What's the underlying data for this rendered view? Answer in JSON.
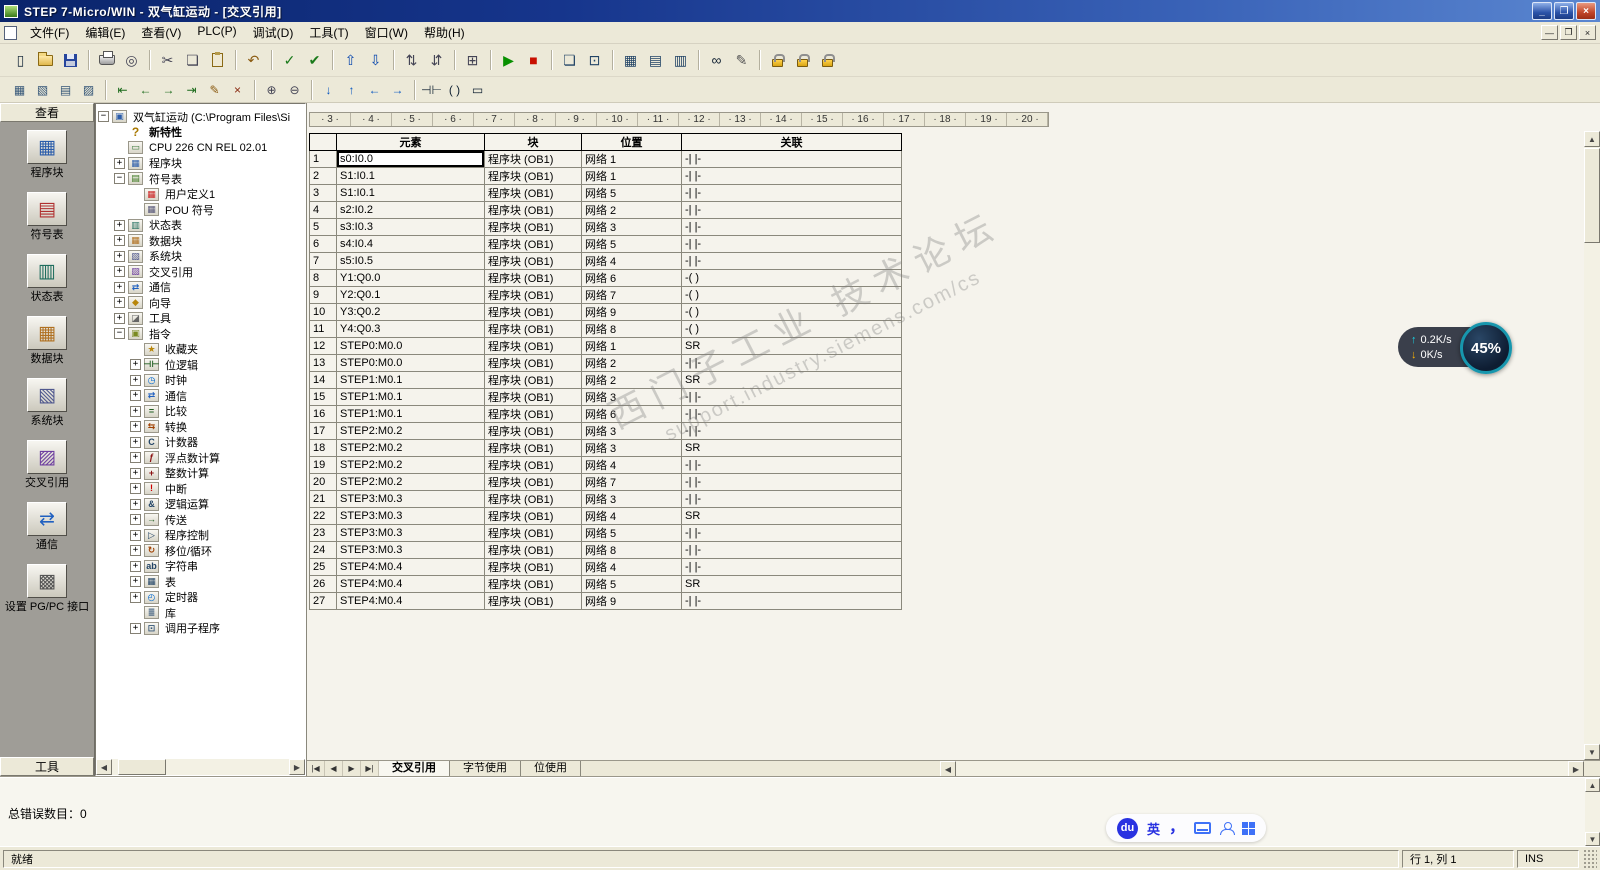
{
  "window": {
    "title": "STEP 7-Micro/WIN - 双气缸运动 - [交叉引用]",
    "buttons": {
      "minimize": "_",
      "restore": "❐",
      "close": "×"
    }
  },
  "mdi": {
    "buttons": {
      "minimize": "—",
      "restore": "❐",
      "close": "×"
    }
  },
  "menu": [
    {
      "key": "file",
      "label": "文件(F)"
    },
    {
      "key": "edit",
      "label": "编辑(E)"
    },
    {
      "key": "view",
      "label": "查看(V)"
    },
    {
      "key": "plc",
      "label": "PLC(P)"
    },
    {
      "key": "debug",
      "label": "调试(D)"
    },
    {
      "key": "tools",
      "label": "工具(T)"
    },
    {
      "key": "window",
      "label": "窗口(W)"
    },
    {
      "key": "help",
      "label": "帮助(H)"
    }
  ],
  "toolbar1": [
    {
      "name": "new",
      "glyph": "▯",
      "color": "#223344"
    },
    {
      "name": "open",
      "css": "folder"
    },
    {
      "name": "save",
      "css": "disk"
    },
    {
      "sep": true
    },
    {
      "name": "print",
      "css": "printer"
    },
    {
      "name": "print-preview",
      "glyph": "◎",
      "color": "#444455"
    },
    {
      "sep": true
    },
    {
      "name": "cut",
      "glyph": "✂",
      "color": "#444455"
    },
    {
      "name": "copy",
      "glyph": "❏",
      "color": "#444455"
    },
    {
      "name": "paste",
      "css": "paste"
    },
    {
      "sep": true
    },
    {
      "name": "undo",
      "glyph": "↶",
      "color": "#8a5a10"
    },
    {
      "sep": true
    },
    {
      "name": "compile",
      "glyph": "✓",
      "color": "#1a7a1a"
    },
    {
      "name": "compile-all",
      "glyph": "✔",
      "color": "#1a7a1a"
    },
    {
      "sep": true
    },
    {
      "name": "upload",
      "glyph": "⇧",
      "color": "#0645ad"
    },
    {
      "name": "download",
      "glyph": "⇩",
      "color": "#0645ad"
    },
    {
      "sep": true
    },
    {
      "name": "sort-ascending",
      "glyph": "⇅",
      "color": "#444455"
    },
    {
      "name": "sort-descending",
      "glyph": "⇵",
      "color": "#444455"
    },
    {
      "sep": true
    },
    {
      "name": "options",
      "glyph": "⊞",
      "color": "#444455"
    },
    {
      "sep": true
    },
    {
      "name": "run",
      "glyph": "▶",
      "color": "#089000"
    },
    {
      "name": "stop",
      "glyph": "■",
      "color": "#c81000"
    },
    {
      "sep": true
    },
    {
      "name": "program-status",
      "glyph": "❏",
      "color": "#224466"
    },
    {
      "name": "pause-program-status",
      "glyph": "⊡",
      "color": "#224466"
    },
    {
      "sep": true
    },
    {
      "name": "symbol-table-view",
      "glyph": "▦",
      "color": "#224466"
    },
    {
      "name": "status-chart-view",
      "glyph": "▤",
      "color": "#224466"
    },
    {
      "name": "data-block-view",
      "glyph": "▥",
      "color": "#224466"
    },
    {
      "sep": true
    },
    {
      "name": "program-monitor",
      "glyph": "∞",
      "color": "#112233"
    },
    {
      "name": "chart-monitor",
      "glyph": "✎",
      "color": "#555555"
    },
    {
      "sep": true
    },
    {
      "name": "force",
      "css": "lock"
    },
    {
      "name": "unforce",
      "css": "lock"
    },
    {
      "name": "unforce-all",
      "css": "lock"
    }
  ],
  "toolbar2": [
    {
      "name": "insert-network",
      "glyph": "▦",
      "color": "#335577"
    },
    {
      "name": "delete-network",
      "glyph": "▧",
      "color": "#335577"
    },
    {
      "name": "pou-comments",
      "glyph": "▤",
      "color": "#335577"
    },
    {
      "name": "view-symbol-info",
      "glyph": "▨",
      "color": "#335577"
    },
    {
      "sep": true
    },
    {
      "name": "goto-first",
      "glyph": "⇤",
      "color": "#1a6a1a"
    },
    {
      "name": "goto-previous",
      "glyph": "←",
      "color": "#1a6a1a"
    },
    {
      "name": "goto-next",
      "glyph": "→",
      "color": "#1a6a1a"
    },
    {
      "name": "goto-last",
      "glyph": "⇥",
      "color": "#1a6a1a"
    },
    {
      "name": "edit-cell",
      "glyph": "✎",
      "color": "#8a5a10"
    },
    {
      "name": "clear-cell",
      "glyph": "×",
      "color": "#8a2a10"
    },
    {
      "sep": true
    },
    {
      "name": "zoom-in",
      "glyph": "⊕",
      "color": "#444455"
    },
    {
      "name": "zoom-out",
      "glyph": "⊖",
      "color": "#444455"
    },
    {
      "sep": true
    },
    {
      "name": "line-down",
      "glyph": "↓",
      "color": "#0a58c0"
    },
    {
      "name": "line-up",
      "glyph": "↑",
      "color": "#0a58c0"
    },
    {
      "name": "line-left",
      "glyph": "←",
      "color": "#0a58c0"
    },
    {
      "name": "line-right",
      "glyph": "→",
      "color": "#0a58c0"
    },
    {
      "sep": true
    },
    {
      "name": "insert-contact",
      "glyph": "⊣⊢",
      "color": "#112233"
    },
    {
      "name": "insert-coil",
      "glyph": "( )",
      "color": "#112233"
    },
    {
      "name": "insert-box",
      "glyph": "▭",
      "color": "#112233"
    }
  ],
  "sidebar": {
    "header": "查看",
    "footer": "工具",
    "items": [
      {
        "key": "program-block",
        "label": "程序块",
        "icon": "program-block-icon",
        "glyph": "▦",
        "color": "#2a5caa"
      },
      {
        "key": "symbol-table",
        "label": "符号表",
        "icon": "symbol-table-icon",
        "glyph": "▤",
        "color": "#b03030"
      },
      {
        "key": "status-chart",
        "label": "状态表",
        "icon": "status-chart-icon",
        "glyph": "▥",
        "color": "#1f6e5e"
      },
      {
        "key": "data-block",
        "label": "数据块",
        "icon": "data-block-icon",
        "glyph": "▦",
        "color": "#b07020"
      },
      {
        "key": "system-block",
        "label": "系统块",
        "icon": "system-block-icon",
        "glyph": "▧",
        "color": "#50588e"
      },
      {
        "key": "cross-reference",
        "label": "交叉引用",
        "icon": "cross-reference-icon",
        "glyph": "▨",
        "color": "#6e3fa0"
      },
      {
        "key": "communications",
        "label": "通信",
        "icon": "communications-icon",
        "glyph": "⇄",
        "color": "#2060c0"
      },
      {
        "key": "set-pg-pc-interface",
        "label": "设置 PG/PC 接口",
        "icon": "set-pg-pc-interface-icon",
        "glyph": "▩",
        "color": "#555555"
      }
    ]
  },
  "tree": {
    "items": [
      {
        "key": "project-root",
        "level": 0,
        "toggle": "minus",
        "icon": "project-icon",
        "glyph": "▣",
        "color": "#2a5caa",
        "label": "双气缸运动 (C:\\Program Files\\Si"
      },
      {
        "key": "new-features",
        "level": 1,
        "toggle": "none",
        "icon": "new-features-icon",
        "glyph": "?",
        "color": "#a87800",
        "nobox": true,
        "bold": true,
        "label": "新特性"
      },
      {
        "key": "cpu",
        "level": 1,
        "toggle": "none",
        "icon": "cpu-icon",
        "glyph": "▭",
        "color": "#3a7a3a",
        "label": "CPU 226 CN REL 02.01"
      },
      {
        "key": "program-block",
        "level": 1,
        "toggle": "plus",
        "icon": "program-block-icon",
        "glyph": "▦",
        "color": "#2a5caa",
        "label": "程序块"
      },
      {
        "key": "symbol-table",
        "level": 1,
        "toggle": "minus",
        "icon": "symbol-table-folder-icon",
        "glyph": "▤",
        "color": "#38761d",
        "label": "符号表"
      },
      {
        "key": "user-defined-1",
        "level": 2,
        "toggle": "none",
        "icon": "user-defined-table-icon",
        "glyph": "▦",
        "color": "#cc2222",
        "label": "用户定义1"
      },
      {
        "key": "pou-symbols",
        "level": 2,
        "toggle": "none",
        "icon": "pou-symbols-icon",
        "glyph": "▦",
        "color": "#555577",
        "label": "POU 符号"
      },
      {
        "key": "status-chart",
        "level": 1,
        "toggle": "plus",
        "icon": "status-chart-icon",
        "glyph": "▥",
        "color": "#1f6e5e",
        "label": "状态表"
      },
      {
        "key": "data-block",
        "level": 1,
        "toggle": "plus",
        "icon": "data-block-icon",
        "glyph": "▦",
        "color": "#b07020",
        "label": "数据块"
      },
      {
        "key": "system-block",
        "level": 1,
        "toggle": "plus",
        "icon": "system-block-icon",
        "glyph": "▧",
        "color": "#50588e",
        "label": "系统块"
      },
      {
        "key": "cross-reference",
        "level": 1,
        "toggle": "plus",
        "icon": "cross-reference-icon",
        "glyph": "▨",
        "color": "#6e3fa0",
        "label": "交叉引用"
      },
      {
        "key": "communications",
        "level": 1,
        "toggle": "plus",
        "icon": "communications-icon",
        "glyph": "⇄",
        "color": "#2060c0",
        "label": "通信"
      },
      {
        "key": "wizards",
        "level": 1,
        "toggle": "plus",
        "icon": "wizard-icon",
        "glyph": "◆",
        "color": "#b8860b",
        "label": "向导"
      },
      {
        "key": "tools",
        "level": 1,
        "toggle": "plus",
        "icon": "tools-icon",
        "glyph": "◪",
        "color": "#666666",
        "label": "工具"
      },
      {
        "key": "instructions",
        "level": 1,
        "toggle": "minus",
        "icon": "instructions-icon",
        "glyph": "▣",
        "color": "#7a8a20",
        "label": "指令"
      },
      {
        "key": "favorites",
        "level": 2,
        "toggle": "none",
        "icon": "favorites-icon",
        "glyph": "★",
        "color": "#b8860b",
        "label": "收藏夹"
      },
      {
        "key": "bit-logic",
        "level": 2,
        "toggle": "plus",
        "icon": "bit-logic-icon",
        "glyph": "⊣⊢",
        "color": "#205e20",
        "label": "位逻辑"
      },
      {
        "key": "clock",
        "level": 2,
        "toggle": "plus",
        "icon": "clock-icon",
        "glyph": "◷",
        "color": "#0066cc",
        "label": "时钟"
      },
      {
        "key": "communications-instructions",
        "level": 2,
        "toggle": "plus",
        "icon": "comm-instructions-icon",
        "glyph": "⇄",
        "color": "#2060c0",
        "label": "通信"
      },
      {
        "key": "compare",
        "level": 2,
        "toggle": "plus",
        "icon": "compare-icon",
        "glyph": "=",
        "color": "#205e20",
        "label": "比较"
      },
      {
        "key": "convert",
        "level": 2,
        "toggle": "plus",
        "icon": "convert-icon",
        "glyph": "⇆",
        "color": "#a04000",
        "label": "转换"
      },
      {
        "key": "counters",
        "level": 2,
        "toggle": "plus",
        "icon": "counters-icon",
        "glyph": "C",
        "color": "#224466",
        "label": "计数器"
      },
      {
        "key": "floating-point-math",
        "level": 2,
        "toggle": "plus",
        "icon": "float-math-icon",
        "glyph": "ƒ",
        "color": "#8a1010",
        "label": "浮点数计算"
      },
      {
        "key": "integer-math",
        "level": 2,
        "toggle": "plus",
        "icon": "integer-math-icon",
        "glyph": "+",
        "color": "#8a1010",
        "label": "整数计算"
      },
      {
        "key": "interrupt",
        "level": 2,
        "toggle": "plus",
        "icon": "interrupt-icon",
        "glyph": "!",
        "color": "#cc0000",
        "label": "中断"
      },
      {
        "key": "logical-operations",
        "level": 2,
        "toggle": "plus",
        "icon": "logic-ops-icon",
        "glyph": "&",
        "color": "#224466",
        "label": "逻辑运算"
      },
      {
        "key": "move",
        "level": 2,
        "toggle": "plus",
        "icon": "move-icon",
        "glyph": "→",
        "color": "#205e20",
        "label": "传送"
      },
      {
        "key": "program-control",
        "level": 2,
        "toggle": "plus",
        "icon": "program-control-icon",
        "glyph": "▷",
        "color": "#224466",
        "label": "程序控制"
      },
      {
        "key": "shift-rotate",
        "level": 2,
        "toggle": "plus",
        "icon": "shift-rotate-icon",
        "glyph": "↻",
        "color": "#a04000",
        "label": "移位/循环"
      },
      {
        "key": "string",
        "level": 2,
        "toggle": "plus",
        "icon": "string-icon",
        "glyph": "ab",
        "color": "#224466",
        "label": "字符串"
      },
      {
        "key": "table",
        "level": 2,
        "toggle": "plus",
        "icon": "table-instructions-icon",
        "glyph": "▦",
        "color": "#224466",
        "label": "表"
      },
      {
        "key": "timers",
        "level": 2,
        "toggle": "plus",
        "icon": "timers-icon",
        "glyph": "◴",
        "color": "#0066cc",
        "label": "定时器"
      },
      {
        "key": "libraries",
        "level": 2,
        "toggle": "none",
        "icon": "libraries-icon",
        "glyph": "≣",
        "color": "#335577",
        "label": "库"
      },
      {
        "key": "call-subroutines",
        "level": 2,
        "toggle": "plus",
        "icon": "call-subroutines-icon",
        "glyph": "⊡",
        "color": "#335577",
        "label": "调用子程序"
      }
    ]
  },
  "ruler": {
    "numbers": [
      3,
      4,
      5,
      6,
      7,
      8,
      9,
      10,
      11,
      12,
      13,
      14,
      15,
      16,
      17,
      18,
      19,
      20
    ]
  },
  "table": {
    "columns": [
      "元素",
      "块",
      "位置",
      "关联"
    ],
    "col_keys": [
      "element",
      "block",
      "location",
      "association"
    ],
    "selected": {
      "row": 0,
      "col": 0
    },
    "rows": [
      [
        "s0:I0.0",
        "程序块 (OB1)",
        "网络 1",
        "-| |-"
      ],
      [
        "S1:I0.1",
        "程序块 (OB1)",
        "网络 1",
        "-| |-"
      ],
      [
        "S1:I0.1",
        "程序块 (OB1)",
        "网络 5",
        "-| |-"
      ],
      [
        "s2:I0.2",
        "程序块 (OB1)",
        "网络 2",
        "-| |-"
      ],
      [
        "s3:I0.3",
        "程序块 (OB1)",
        "网络 3",
        "-| |-"
      ],
      [
        "s4:I0.4",
        "程序块 (OB1)",
        "网络 5",
        "-| |-"
      ],
      [
        "s5:I0.5",
        "程序块 (OB1)",
        "网络 4",
        "-| |-"
      ],
      [
        "Y1:Q0.0",
        "程序块 (OB1)",
        "网络 6",
        "-( )"
      ],
      [
        "Y2:Q0.1",
        "程序块 (OB1)",
        "网络 7",
        "-( )"
      ],
      [
        "Y3:Q0.2",
        "程序块 (OB1)",
        "网络 9",
        "-( )"
      ],
      [
        "Y4:Q0.3",
        "程序块 (OB1)",
        "网络 8",
        "-( )"
      ],
      [
        "STEP0:M0.0",
        "程序块 (OB1)",
        "网络 1",
        "SR"
      ],
      [
        "STEP0:M0.0",
        "程序块 (OB1)",
        "网络 2",
        "-| |-"
      ],
      [
        "STEP1:M0.1",
        "程序块 (OB1)",
        "网络 2",
        "SR"
      ],
      [
        "STEP1:M0.1",
        "程序块 (OB1)",
        "网络 3",
        "-| |-"
      ],
      [
        "STEP1:M0.1",
        "程序块 (OB1)",
        "网络 6",
        "-| |-"
      ],
      [
        "STEP2:M0.2",
        "程序块 (OB1)",
        "网络 3",
        "-| |-"
      ],
      [
        "STEP2:M0.2",
        "程序块 (OB1)",
        "网络 3",
        "SR"
      ],
      [
        "STEP2:M0.2",
        "程序块 (OB1)",
        "网络 4",
        "-| |-"
      ],
      [
        "STEP2:M0.2",
        "程序块 (OB1)",
        "网络 7",
        "-| |-"
      ],
      [
        "STEP3:M0.3",
        "程序块 (OB1)",
        "网络 3",
        "-| |-"
      ],
      [
        "STEP3:M0.3",
        "程序块 (OB1)",
        "网络 4",
        "SR"
      ],
      [
        "STEP3:M0.3",
        "程序块 (OB1)",
        "网络 5",
        "-| |-"
      ],
      [
        "STEP3:M0.3",
        "程序块 (OB1)",
        "网络 8",
        "-| |-"
      ],
      [
        "STEP4:M0.4",
        "程序块 (OB1)",
        "网络 4",
        "-| |-"
      ],
      [
        "STEP4:M0.4",
        "程序块 (OB1)",
        "网络 5",
        "SR"
      ],
      [
        "STEP4:M0.4",
        "程序块 (OB1)",
        "网络 9",
        "-| |-"
      ]
    ]
  },
  "tabs": {
    "nav": [
      {
        "name": "first-tab-button",
        "glyph": "|◀"
      },
      {
        "name": "previous-tab-button",
        "glyph": "◀"
      },
      {
        "name": "next-tab-button",
        "glyph": "▶"
      },
      {
        "name": "last-tab-button",
        "glyph": "▶|"
      }
    ],
    "items": [
      {
        "key": "cross-reference",
        "label": "交叉引用",
        "active": true
      },
      {
        "key": "byte-usage",
        "label": "字节使用",
        "active": false
      },
      {
        "key": "bit-usage",
        "label": "位使用",
        "active": false
      }
    ]
  },
  "scroll": {
    "up": "▲",
    "down": "▼",
    "left": "◀",
    "right": "▶"
  },
  "output": {
    "label": "总错误数目：0"
  },
  "statusbar": {
    "ready": "就绪",
    "position": "行 1, 列 1",
    "mode": "INS"
  },
  "speed_widget": {
    "up_icon": "↑",
    "upload": "0.2K/s",
    "down_icon": "↓",
    "download": "0K/s",
    "percent": "45%"
  },
  "ime": {
    "logo": "du",
    "lang": "英",
    "comma": "，"
  },
  "watermark": {
    "line1": "西门子工业 技术论坛",
    "line2": "support.industry.siemens.com/cs"
  }
}
